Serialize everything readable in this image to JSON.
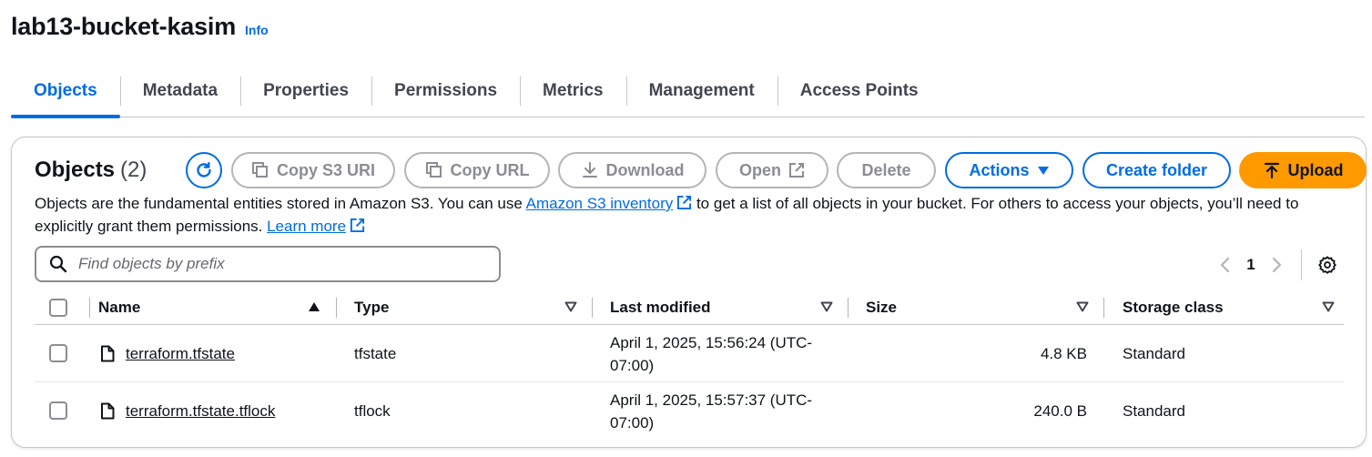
{
  "header": {
    "title": "lab13-bucket-kasim",
    "info": "Info"
  },
  "tabs": [
    {
      "label": "Objects",
      "active": true
    },
    {
      "label": "Metadata"
    },
    {
      "label": "Properties"
    },
    {
      "label": "Permissions"
    },
    {
      "label": "Metrics"
    },
    {
      "label": "Management"
    },
    {
      "label": "Access Points"
    }
  ],
  "panel": {
    "title": "Objects",
    "count": "(2)",
    "buttons": {
      "copy_s3_uri": "Copy S3 URI",
      "copy_url": "Copy URL",
      "download": "Download",
      "open": "Open",
      "delete": "Delete",
      "actions": "Actions",
      "create_folder": "Create folder",
      "upload": "Upload"
    },
    "description": {
      "part1": "Objects are the fundamental entities stored in Amazon S3. You can use ",
      "inventory_link": "Amazon S3 inventory",
      "part2": " to get a list of all objects in your bucket. For others to access your objects, you’ll need to explicitly grant them permissions. ",
      "learn_more": "Learn more"
    },
    "search": {
      "placeholder": "Find objects by prefix",
      "value": ""
    },
    "pagination": {
      "current_page": "1"
    }
  },
  "table": {
    "columns": [
      "Name",
      "Type",
      "Last modified",
      "Size",
      "Storage class"
    ],
    "rows": [
      {
        "name": "terraform.tfstate",
        "type": "tfstate",
        "modified_1": "April 1, 2025, 15:56:24 (UTC-",
        "modified_2": "07:00)",
        "size": "4.8 KB",
        "storage_class": "Standard"
      },
      {
        "name": "terraform.tfstate.tflock",
        "type": "tflock",
        "modified_1": "April 1, 2025, 15:57:37 (UTC-",
        "modified_2": "07:00)",
        "size": "240.0 B",
        "storage_class": "Standard"
      }
    ]
  },
  "colors": {
    "accent": "#006ce0",
    "upload": "#ff9900",
    "disabled": "#8c8c94",
    "text": "#0f141a"
  },
  "icons": [
    "refresh-icon",
    "copy-icon",
    "download-icon",
    "external-link-icon",
    "caret-down-icon",
    "upload-icon",
    "search-icon",
    "chevron-left-icon",
    "chevron-right-icon",
    "settings-icon",
    "sort-asc-icon",
    "sort-icon",
    "file-icon"
  ]
}
